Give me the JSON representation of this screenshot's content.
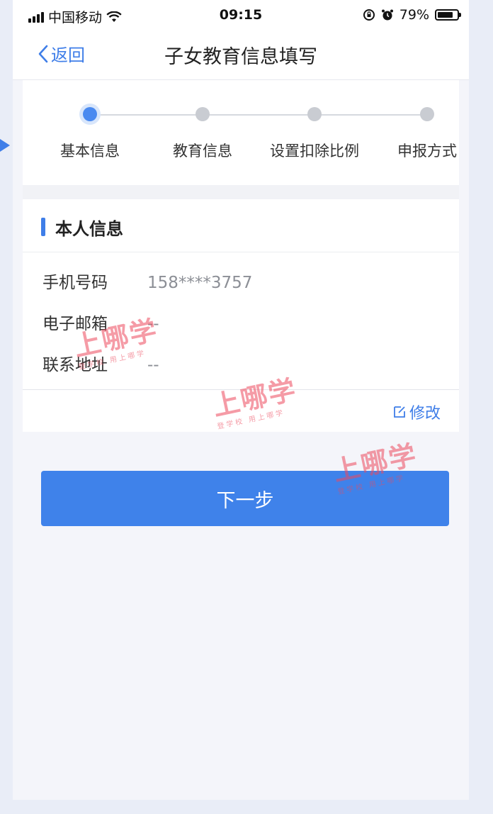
{
  "status_bar": {
    "carrier": "中国移动",
    "time": "09:15",
    "battery": "79%",
    "battery_level": 0.79
  },
  "nav": {
    "back_label": "返回",
    "title": "子女教育信息填写"
  },
  "steps": [
    {
      "label": "基本信息",
      "active": true
    },
    {
      "label": "教育信息",
      "active": false
    },
    {
      "label": "设置扣除比例",
      "active": false
    },
    {
      "label": "申报方式",
      "active": false
    }
  ],
  "section": {
    "title": "本人信息",
    "fields": [
      {
        "label": "手机号码",
        "value": "158****3757"
      },
      {
        "label": "电子邮箱",
        "value": "--"
      },
      {
        "label": "联系地址",
        "value": "--"
      }
    ],
    "edit_label": "修改"
  },
  "next_button": {
    "label": "下一步"
  },
  "watermark": {
    "brand": "上哪学",
    "tagline": "登学校 用上哪学"
  },
  "colors": {
    "accent": "#3f82ea",
    "watermark": "#ec495c"
  }
}
